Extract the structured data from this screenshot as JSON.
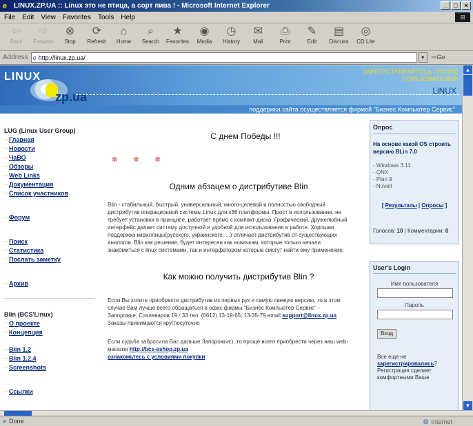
{
  "window": {
    "title": "LINUX.ZP.UA :: Linux это не птица, а сорт пива ! - Microsoft Internet Explorer",
    "controls": [
      "_",
      "□",
      "×"
    ]
  },
  "menu": [
    "File",
    "Edit",
    "View",
    "Favorites",
    "Tools",
    "Help"
  ],
  "toolbar": [
    {
      "label": "Back",
      "icon": "back-arrow-icon",
      "glyph": "⇦",
      "enabled": false
    },
    {
      "label": "Forward",
      "icon": "forward-arrow-icon",
      "glyph": "⇨",
      "enabled": false
    },
    {
      "label": "Stop",
      "icon": "stop-icon",
      "glyph": "⊗",
      "enabled": true
    },
    {
      "label": "Refresh",
      "icon": "refresh-icon",
      "glyph": "⟳",
      "enabled": true
    },
    {
      "label": "Home",
      "icon": "home-icon",
      "glyph": "⌂",
      "enabled": true
    },
    {
      "label": "Search",
      "icon": "search-icon",
      "glyph": "⌕",
      "enabled": true
    },
    {
      "label": "Favorites",
      "icon": "favorites-icon",
      "glyph": "★",
      "enabled": true
    },
    {
      "label": "Media",
      "icon": "media-icon",
      "glyph": "◉",
      "enabled": true
    },
    {
      "label": "History",
      "icon": "history-icon",
      "glyph": "◷",
      "enabled": true
    },
    {
      "label": "Mail",
      "icon": "mail-icon",
      "glyph": "✉",
      "enabled": true
    },
    {
      "label": "Print",
      "icon": "print-icon",
      "glyph": "⎙",
      "enabled": true
    },
    {
      "label": "Edit",
      "icon": "edit-icon",
      "glyph": "✎",
      "enabled": true
    },
    {
      "label": "Discuss",
      "icon": "discuss-icon",
      "glyph": "▤",
      "enabled": true
    },
    {
      "label": "CD Lite",
      "icon": "cd-icon",
      "glyph": "◎",
      "enabled": true
    }
  ],
  "address": {
    "label": "Address",
    "url": "http://linux.zp.ua/",
    "go": "Go"
  },
  "banner": {
    "logo_text": "LINUX",
    "logo_domain": "zp.ua",
    "slogan": "ЗАРЕГИСТРИРУЙТЕСЬ ГРУППЕ ПОЛЬЗОВАТЕЛЕЙ!",
    "brand_right": "LiNUX",
    "support": "поддержка сайта осуществляется фирмой \"Бизнес Компьютер Сервис\""
  },
  "sidebar": {
    "group1_title": "LUG (Linux User Group)",
    "group1_items": [
      "Главная",
      "Новости",
      "ЧаВО",
      "Обзоры",
      "Web Links",
      "Документация",
      "Список участников"
    ],
    "forum": "Форум",
    "tools_items": [
      "Поиск",
      "Статистика",
      "Послать заметку"
    ],
    "archive": "Архив",
    "group2_title": "Blin (BCS'Linux)",
    "group2_items": [
      "О проекте",
      "Концепция"
    ],
    "version_items": [
      "Blin 1.2",
      "Blin 1.2.4",
      "Screenshots"
    ],
    "links": "Ссылки"
  },
  "content": {
    "h1": "С днем Победы !!!",
    "decor": "✽ ✽ ✽",
    "h2": "Одним абзацем о дистрибутиве Blin",
    "p1": "Blin - стабильный, быстрый, универсальный, много-целевой и полностью свободный дистрибутив операционной системы Linux для x86 платформы. Прост в использовании, не требует установки в принципе, работает прямо с компакт-диска. Графический, дружелюбный интерфейс делает систему доступной и удобной для использования в работе. Хорошая поддержка кириллицы(русского, украинского, ...) отличает дистрибутив от существующих аналогов. Blin как решение, будет интересен как новичкам, которые только начали знакомиться с linux системами, так и интерфатором которые смогут найти ему применение.",
    "h3": "Как можно получить дистрибутив Blin ?",
    "p2_text": "Если Вы хотите приобрести дистрибутив из первых рук и самую свежую версию, то в этом случае Вам лучше всего обращаться в офис фирмы \"Бизнес Компьютер Сервис\" - Запорожье, Сталеваров 19 / 33 тел. (0612) 13-19-65; 13-35-79 email ",
    "p2_email": "support@linux.zp.ua",
    "p2_tail": "Заказы принимаются круглосуточно",
    "p3_text": "Если судьба забросила Вас дальше Запорожья:), то проще всего приобрести через наш web-магазин ",
    "p3_link": "http://bcs-eshop.zp.ua",
    "p3_link2": "ознакомьтесь с условиями покупки"
  },
  "poll": {
    "title": "Опрос",
    "question": "На основе какой OS строить версию BLin 7.0",
    "options": [
      "Windows 3.11",
      "QNX",
      "Plan 9",
      "Novell"
    ],
    "results": "Результаты",
    "polls": "Опросы",
    "votes_label": "Голосов:",
    "votes": "10",
    "comments_label": "Комментарии:",
    "comments": "0"
  },
  "login": {
    "title": "User's Login",
    "username_label": "Имя пользователя",
    "password_label": "Пароль",
    "submit": "Вход",
    "note_pre": "Все еще не ",
    "note_link": "зарегистрировались",
    "note_post": "? Регистрация сделает комфортными Ваше"
  },
  "status": {
    "text": "Done",
    "zone": "Internet"
  },
  "colors": {
    "titlebar": "#0a246a",
    "banner": "#5fa1dc",
    "link": "#0a2b7c",
    "bullet": "#ff8a00",
    "slogan": "#f4d820"
  }
}
